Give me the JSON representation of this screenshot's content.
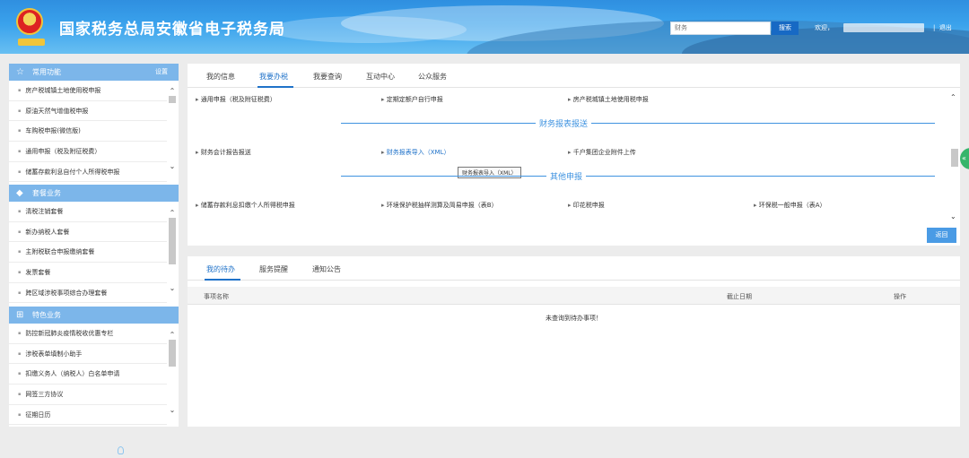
{
  "header": {
    "site_title": "国家税务总局安徽省电子税务局",
    "search_placeholder": "财务",
    "search_button": "搜索",
    "welcome": "欢迎，",
    "divider": "|",
    "logout": "退出",
    "colors": {
      "header_blue": "#3aa2ec",
      "accent": "#1f72c9"
    }
  },
  "sidebar": {
    "common": {
      "title": "常用功能",
      "setting": "设置",
      "icon": "star-icon",
      "items": [
        "房产税城镇土地使用税申报",
        "原油天然气增值税申报",
        "车购税申报(微信版)",
        "通用申报（税及附征税费）",
        "储蓄存款利息自付个人所得税申报"
      ]
    },
    "package": {
      "title": "套餐业务",
      "icon": "package-icon",
      "items": [
        "清税注销套餐",
        "新办纳税人套餐",
        "主附税联合申报缴纳套餐",
        "发票套餐",
        "跨区域涉税事项综合办理套餐"
      ]
    },
    "special": {
      "title": "特色业务",
      "icon": "grid-icon",
      "items": [
        "防控新冠肺炎疫情税收优惠专栏",
        "涉税表单填制小助手",
        "扣缴义务人（纳税人）白名单申请",
        "网签三方协议",
        "征期日历"
      ]
    }
  },
  "top_panel": {
    "tabs": [
      "我的信息",
      "我要办税",
      "我要查询",
      "互动中心",
      "公众服务"
    ],
    "active_tab": 1,
    "row1": [
      "通用申报（税及附征税费）",
      "定期定额户自行申报",
      "房产税城镇土地使用税申报"
    ],
    "section_finance": "财务报表报送",
    "row2": [
      "财务会计报告报送",
      "财务报表导入（XML）",
      "千户集团企业附件上传"
    ],
    "tooltip": "财务报表导入（XML）",
    "section_other": "其他申报",
    "row3": [
      "储蓄存款利息扣缴个人所得税申报",
      "环境保护税抽样测算及简易申报（表B）",
      "印花税申报",
      "环保税一般申报（表A）"
    ],
    "back_button": "返回"
  },
  "bottom_panel": {
    "tabs": [
      "我的待办",
      "服务提醒",
      "通知公告"
    ],
    "active_tab": 0,
    "columns": [
      "事项名称",
      "截止日期",
      "操作"
    ],
    "empty_text": "未查询到待办事项！"
  }
}
